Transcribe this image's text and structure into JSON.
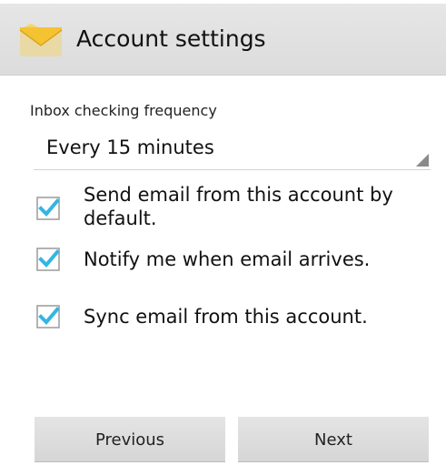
{
  "header": {
    "title": "Account settings",
    "icon": "email-app-icon"
  },
  "settings": {
    "frequency_label": "Inbox checking frequency",
    "frequency_value": "Every 15 minutes",
    "options": [
      {
        "label": "Send email from this account by default.",
        "checked": true
      },
      {
        "label": "Notify me when email arrives.",
        "checked": true
      },
      {
        "label": "Sync email from this account.",
        "checked": true
      }
    ]
  },
  "footer": {
    "previous_label": "Previous",
    "next_label": "Next"
  },
  "colors": {
    "accent": "#33b5e5",
    "action_bar": "#e2e2e2",
    "button": "#dcdcdc"
  }
}
